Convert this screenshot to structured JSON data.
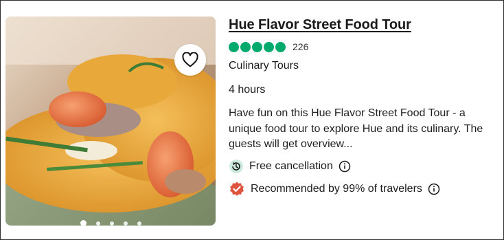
{
  "listing": {
    "title": "Hue Flavor Street Food Tour",
    "rating_bubbles": 5,
    "review_count": "226",
    "category": "Culinary Tours",
    "duration": "4 hours",
    "description": "Have fun on this Hue Flavor Street Food Tour - a unique food tour to explore Hue and its culinary. The guests will get overview...",
    "features": [
      {
        "label": "Free cancellation",
        "icon": "clock-arrow-icon"
      },
      {
        "label": "Recommended by 99% of travelers",
        "icon": "verified-badge-icon"
      }
    ]
  },
  "carousel": {
    "total_slides": 5,
    "active_slide": 1
  },
  "colors": {
    "rating_green": "#00aa6c",
    "badge_red": "#e0533d",
    "cancel_green_bg": "#cdebdd"
  }
}
